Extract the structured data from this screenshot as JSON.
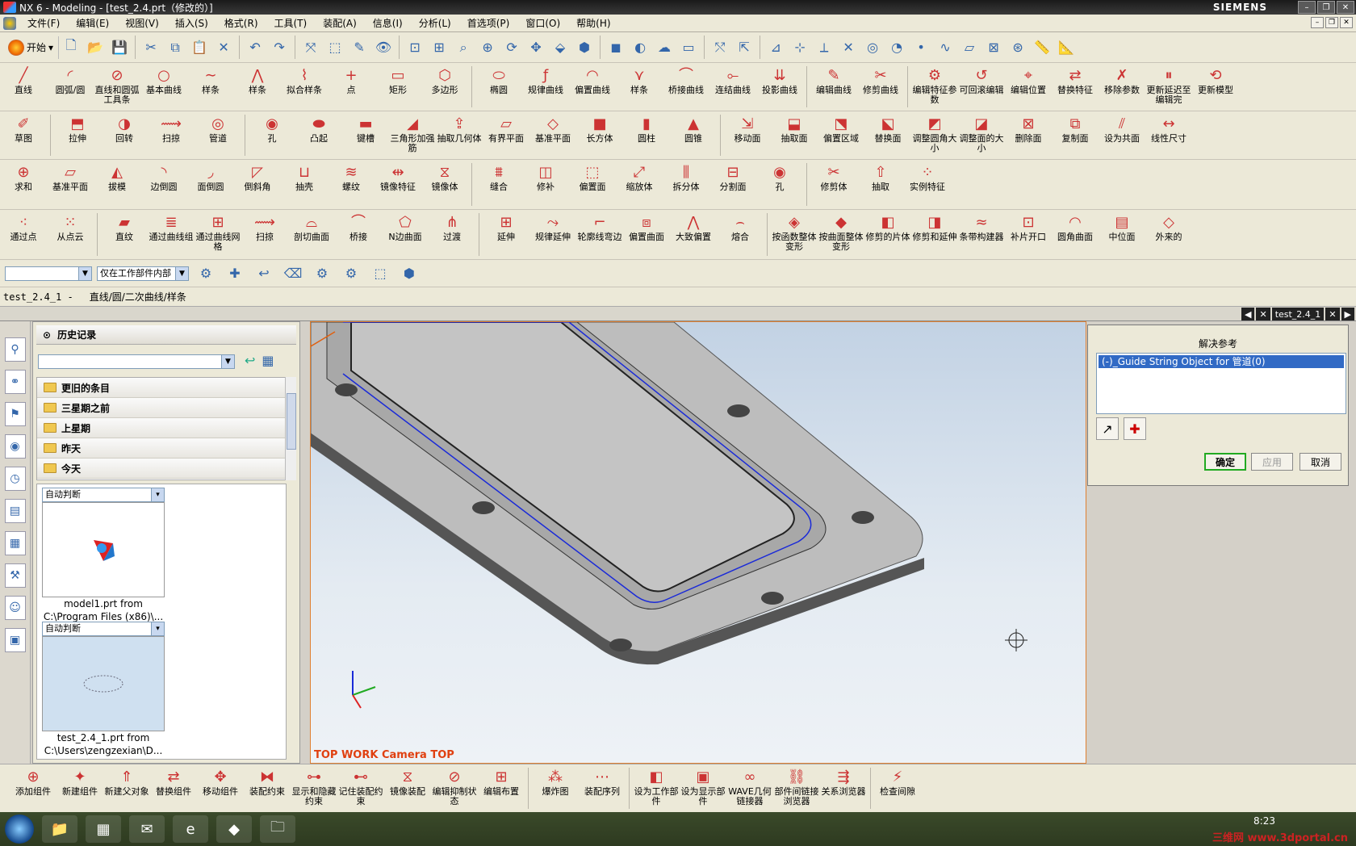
{
  "window": {
    "title": "NX 6 - Modeling - [test_2.4.prt（修改的）]",
    "brand": "SIEMENS"
  },
  "menu": [
    "文件(F)",
    "编辑(E)",
    "视图(V)",
    "插入(S)",
    "格式(R)",
    "工具(T)",
    "装配(A)",
    "信息(I)",
    "分析(L)",
    "首选项(P)",
    "窗口(O)",
    "帮助(H)"
  ],
  "toolbar_main": {
    "start_label": "开始"
  },
  "row_curves": [
    "直线",
    "圆弧/圆",
    "直线和圆弧工具条",
    "基本曲线",
    "样条",
    "样条",
    "拟合样条",
    "点",
    "矩形",
    "多边形",
    "椭圆",
    "规律曲线",
    "偏置曲线",
    "样条",
    "桥接曲线",
    "连结曲线",
    "投影曲线",
    "编辑曲线",
    "修剪曲线",
    "编辑特征参数",
    "可回滚编辑",
    "编辑位置",
    "替换特征",
    "移除参数",
    "更新延迟至编辑完",
    "更新模型"
  ],
  "row_features": [
    "草图",
    "拉伸",
    "回转",
    "扫掠",
    "管道",
    "孔",
    "凸起",
    "键槽",
    "三角形加强筋",
    "抽取几何体",
    "有界平面",
    "基准平面",
    "长方体",
    "圆柱",
    "圆锥",
    "移动面",
    "抽取面",
    "偏置区域",
    "替换面",
    "调整圆角大小",
    "调整面的大小",
    "删除面",
    "复制面",
    "设为共面",
    "线性尺寸"
  ],
  "row_ops": [
    "求和",
    "基准平面",
    "拔模",
    "边倒圆",
    "面倒圆",
    "倒斜角",
    "抽壳",
    "螺纹",
    "镜像特征",
    "镜像体",
    "缝合",
    "修补",
    "偏置面",
    "缩放体",
    "拆分体",
    "分割面",
    "孔",
    "修剪体",
    "抽取",
    "实例特征"
  ],
  "row_surfaces": [
    "通过点",
    "从点云",
    "直纹",
    "通过曲线组",
    "通过曲线网格",
    "扫掠",
    "剖切曲面",
    "桥接",
    "N边曲面",
    "过渡",
    "延伸",
    "规律延伸",
    "轮廓线弯边",
    "偏置曲面",
    "大致偏置",
    "熔合",
    "按函数整体变形",
    "按曲面整体变形",
    "修剪的片体",
    "修剪和延伸",
    "条带构建器",
    "补片开口",
    "圆角曲面",
    "中位面",
    "外来的"
  ],
  "selection_bar": {
    "filter_value": "",
    "scope_value": "仅在工作部件内部"
  },
  "status": {
    "part": "test_2.4_1 -",
    "prompt": "直线/圆/二次曲线/样条"
  },
  "graphics_tab": {
    "name": "test_2.4_1"
  },
  "history": {
    "title": "历史记录",
    "folders": [
      "更旧的条目",
      "三星期之前",
      "上星期",
      "昨天",
      "今天"
    ],
    "cards": [
      {
        "combo": "自动判断",
        "caption1": "model1.prt from",
        "caption2": "C:\\Program Files (x86)\\..."
      },
      {
        "combo": "自动判断",
        "caption1": "test_2.4_1.prt from",
        "caption2": "C:\\Users\\zengzexian\\D..."
      }
    ]
  },
  "viewport": {
    "label": "TOP WORK Camera TOP"
  },
  "dialog": {
    "title": "解决参考",
    "item": "(-)_Guide String Object for 管道(0)",
    "ok": "确定",
    "apply": "应用",
    "cancel": "取消"
  },
  "row_assembly": [
    "添加组件",
    "新建组件",
    "新建父对象",
    "替换组件",
    "移动组件",
    "装配约束",
    "显示和隐藏约束",
    "记住装配约束",
    "镜像装配",
    "编辑抑制状态",
    "编辑布置",
    "爆炸图",
    "装配序列",
    "设为工作部件",
    "设为显示部件",
    "WAVE几何链接器",
    "部件间链接浏览器",
    "关系浏览器",
    "检查间隙"
  ],
  "taskbar": {
    "time": "8:23"
  },
  "watermark": "三维网 www.3dportal.cn"
}
